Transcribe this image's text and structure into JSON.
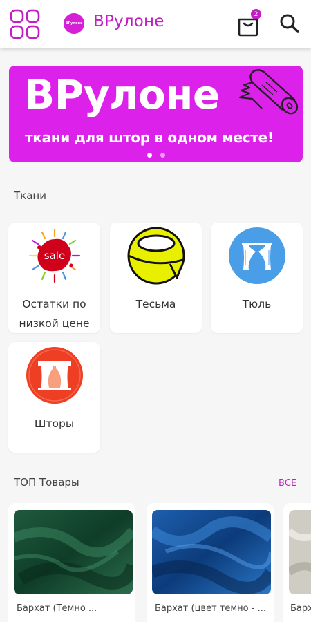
{
  "header": {
    "logo_text": "ВРулоне",
    "title": "ВРулоне",
    "cart_count": "2"
  },
  "banner": {
    "title": "ВРулоне",
    "subtitle": "ткани для штор в одном месте!"
  },
  "fabrics_section": {
    "title": "Ткани",
    "categories": [
      {
        "label": "Остатки по низкой цене",
        "icon": "sale-icon",
        "badge": "sale"
      },
      {
        "label": "Тесьма",
        "icon": "tape-roll-icon"
      },
      {
        "label": "Тюль",
        "icon": "tulle-curtain-icon"
      },
      {
        "label": "Шторы",
        "icon": "window-curtains-icon"
      }
    ]
  },
  "top_section": {
    "title": "ТОП Товары",
    "see_all": "ВСЕ",
    "products": [
      {
        "name": "Бархат (Темно ...",
        "image": "green-velvet"
      },
      {
        "name": "Бархат (цвет темно - ...",
        "image": "blue-velvet"
      },
      {
        "name": "Барх...",
        "image": "grey-fabric"
      }
    ]
  },
  "colors": {
    "accent": "#c21ec4",
    "banner": "#dc22ea",
    "background": "#f6f6f6"
  }
}
